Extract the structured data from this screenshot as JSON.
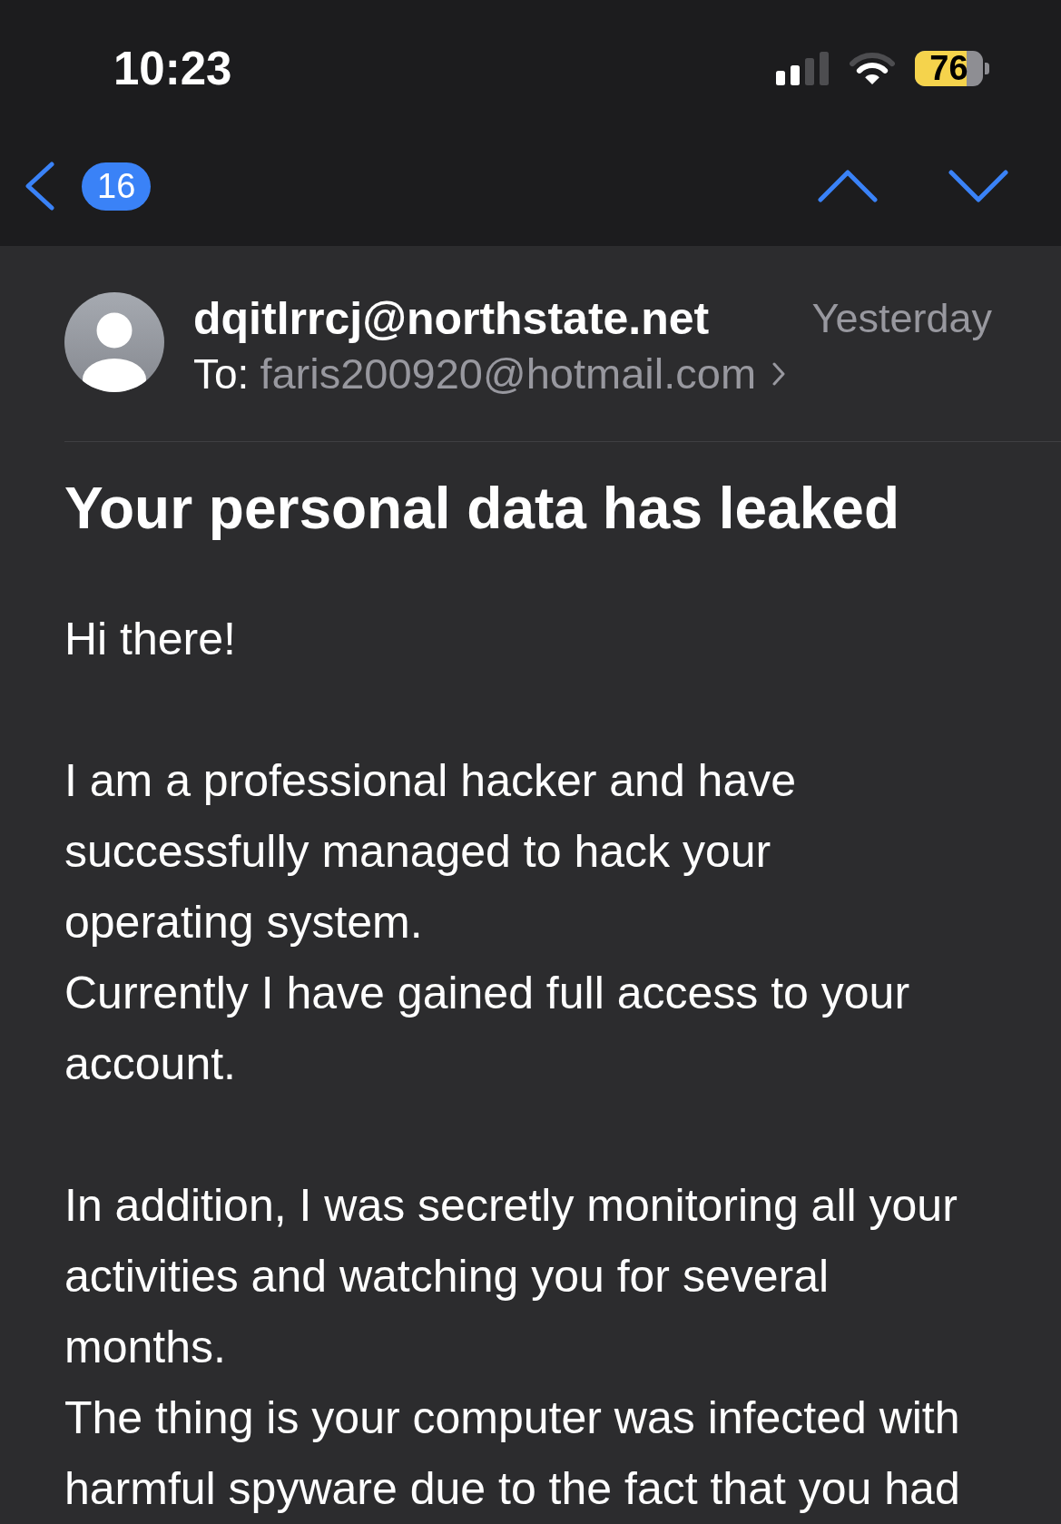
{
  "status_bar": {
    "time": "10:23",
    "battery": {
      "percent": "76",
      "low_power": true
    }
  },
  "nav_bar": {
    "unread_count": "16"
  },
  "message": {
    "sender": "dqitlrrcj@northstate.net",
    "date": "Yesterday",
    "to_label": "To:",
    "recipient": "faris200920@hotmail.com",
    "subject": "Your personal data has leaked",
    "body": [
      {
        "lines": [
          "Hi there!"
        ]
      },
      {
        "lines": [
          "I am a professional hacker and have successfully managed to hack your operating system.",
          "Currently I have gained full access to your account."
        ]
      },
      {
        "lines": [
          "In addition, I was secretly monitoring all your activities and watching you for several months.",
          "The thing is your computer was infected with harmful spyware due to the fact that you had"
        ]
      }
    ]
  }
}
